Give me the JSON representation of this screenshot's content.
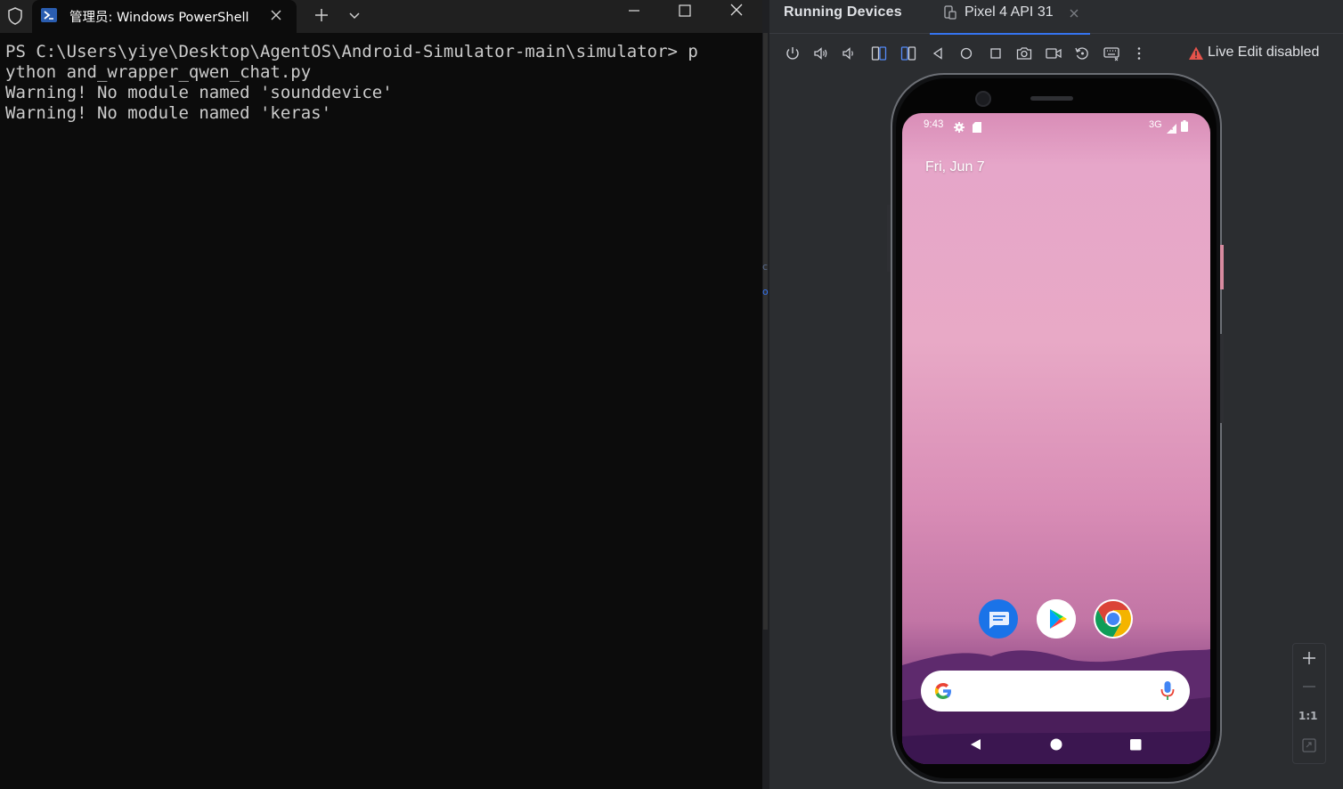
{
  "powershell": {
    "tab_title": "管理员: Windows PowerShell",
    "console_lines": [
      "PS C:\\Users\\yiye\\Desktop\\AgentOS\\Android-Simulator-main\\simulator> p",
      "ython and_wrapper_qwen_chat.py",
      "Warning! No module named 'sounddevice'",
      "Warning! No module named 'keras'"
    ],
    "icons": {
      "shield": "shield-icon",
      "tab": "powershell-icon",
      "close_tab": "close-icon",
      "new_tab": "plus-icon",
      "dropdown": "chevron-down-icon",
      "minimize": "minimize-icon",
      "maximize": "maximize-icon",
      "close_window": "close-icon"
    }
  },
  "divider": {
    "mark_top": "c",
    "mark_bottom": "o"
  },
  "android_studio": {
    "panel_title": "Running Devices",
    "device_tab": "Pixel 4 API 31",
    "live_edit": "Live Edit disabled",
    "live_edit_color": "#e5534b",
    "accent": "#3574f0",
    "toolbar_icons": [
      "power-icon",
      "volume-up-icon",
      "volume-down-icon",
      "rotate-left-icon",
      "rotate-right-icon",
      "back-icon",
      "home-icon",
      "overview-icon",
      "camera-icon",
      "screen-record-icon",
      "reset-icon",
      "keyboard-icon",
      "more-icon"
    ],
    "zoom": {
      "one_to_one": "1:1"
    }
  },
  "phone": {
    "status": {
      "time": "9:43",
      "network": "3G"
    },
    "date": "Fri, Jun 7",
    "dock_apps": [
      "Messages",
      "Play Store",
      "Chrome"
    ],
    "nav": [
      "back",
      "home",
      "recents"
    ]
  }
}
